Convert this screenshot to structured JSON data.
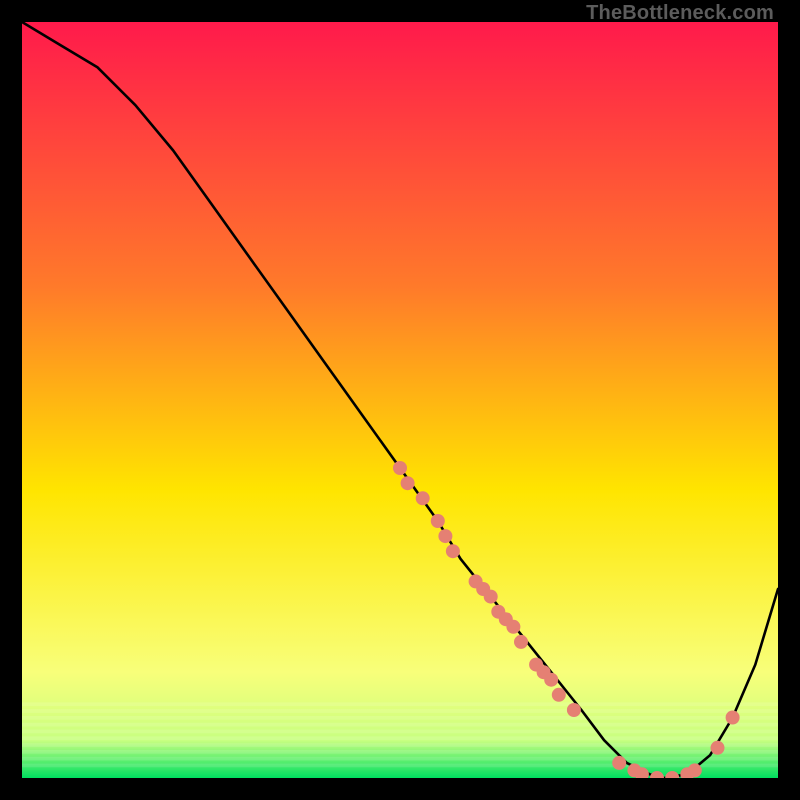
{
  "watermark": "TheBottleneck.com",
  "chart_data": {
    "type": "line",
    "title": "",
    "xlabel": "",
    "ylabel": "",
    "xlim": [
      0,
      100
    ],
    "ylim": [
      0,
      100
    ],
    "grid": false,
    "legend": false,
    "background_gradient": {
      "top": "#ff1a4b",
      "mid1": "#ff7a2a",
      "mid2": "#ffe500",
      "mid3": "#f8ff7a",
      "band": "#c8ff80",
      "bottom": "#00e060"
    },
    "curve_x": [
      0,
      5,
      10,
      15,
      20,
      25,
      30,
      35,
      40,
      45,
      50,
      55,
      58,
      62,
      66,
      70,
      74,
      77,
      80,
      83,
      85,
      88,
      91,
      94,
      97,
      100
    ],
    "curve_y": [
      100,
      97,
      94,
      89,
      83,
      76,
      69,
      62,
      55,
      48,
      41,
      34,
      29,
      24,
      19,
      14,
      9,
      5,
      2,
      0.5,
      0,
      0.5,
      3,
      8,
      15,
      25
    ],
    "series": [
      {
        "name": "markers",
        "type": "scatter",
        "color": "#e58073",
        "points": [
          {
            "x": 50,
            "y": 41
          },
          {
            "x": 51,
            "y": 39
          },
          {
            "x": 53,
            "y": 37
          },
          {
            "x": 55,
            "y": 34
          },
          {
            "x": 56,
            "y": 32
          },
          {
            "x": 57,
            "y": 30
          },
          {
            "x": 60,
            "y": 26
          },
          {
            "x": 61,
            "y": 25
          },
          {
            "x": 62,
            "y": 24
          },
          {
            "x": 63,
            "y": 22
          },
          {
            "x": 64,
            "y": 21
          },
          {
            "x": 65,
            "y": 20
          },
          {
            "x": 66,
            "y": 18
          },
          {
            "x": 68,
            "y": 15
          },
          {
            "x": 69,
            "y": 14
          },
          {
            "x": 70,
            "y": 13
          },
          {
            "x": 71,
            "y": 11
          },
          {
            "x": 73,
            "y": 9
          },
          {
            "x": 79,
            "y": 2
          },
          {
            "x": 81,
            "y": 1
          },
          {
            "x": 82,
            "y": 0.5
          },
          {
            "x": 84,
            "y": 0
          },
          {
            "x": 86,
            "y": 0
          },
          {
            "x": 88,
            "y": 0.5
          },
          {
            "x": 89,
            "y": 1
          },
          {
            "x": 92,
            "y": 4
          },
          {
            "x": 94,
            "y": 8
          }
        ]
      }
    ]
  }
}
